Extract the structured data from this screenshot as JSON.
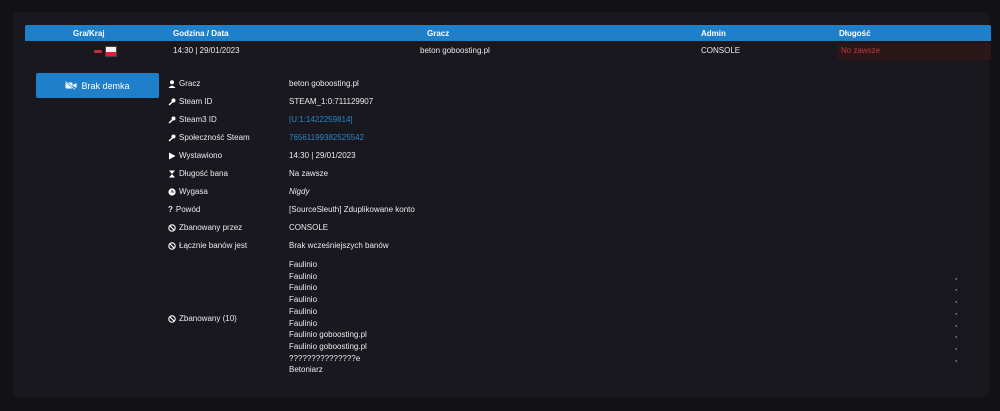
{
  "table": {
    "headers": {
      "game_country": "Gra/Kraj",
      "time_date": "Godzina / Data",
      "player": "Gracz",
      "admin": "Admin",
      "length": "Długość"
    },
    "row": {
      "time_date": "14:30 | 29/01/2023",
      "player": "beton goboosting.pl",
      "admin": "CONSOLE",
      "length": "No zawsze"
    }
  },
  "demo_button": {
    "label": "Brak demka"
  },
  "details": [
    {
      "label": "Gracz",
      "value": "beton goboosting.pl"
    },
    {
      "label": "Steam ID",
      "value": "STEAM_1:0:711129907"
    },
    {
      "label": "Steam3 ID",
      "value": "[U:1:1422259814]"
    },
    {
      "label": "Społeczność Steam",
      "value": "76561199382525542"
    },
    {
      "label": "Wystawiono",
      "value": "14:30 | 29/01/2023"
    },
    {
      "label": "Długość bana",
      "value": "Na zawsze"
    },
    {
      "label": "Wygasa",
      "value": "Nigdy"
    },
    {
      "label": "Powód",
      "value": "[SourceSleuth] Zduplikowane konto"
    },
    {
      "label": "Zbanowany przez",
      "value": "CONSOLE"
    },
    {
      "label": "Łącznie banów jest",
      "value": "Brak wcześniejszych banów"
    }
  ],
  "banned": {
    "label": "Zbanowany (10)",
    "names": [
      "Faulinio",
      "Faulinio",
      "Faulinio",
      "Faulinio",
      "Faulinio",
      "Faulinio",
      "Faulinio goboosting.pl",
      "Faulinio goboosting.pl",
      "???????????????e",
      "Betoniarz"
    ],
    "separator": ","
  },
  "colors": {
    "accent": "#1f7fc9",
    "link": "#2a86cc",
    "danger": "#c0393e"
  }
}
